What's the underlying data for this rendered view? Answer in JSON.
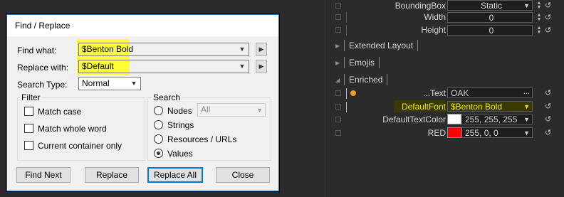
{
  "dialog": {
    "title": "Find / Replace",
    "find_label": "Find what:",
    "find_value": "$Benton Bold",
    "replace_label": "Replace with:",
    "replace_value": "$Default",
    "search_type_label": "Search Type:",
    "search_type_value": "Normal",
    "filter": {
      "title": "Filter",
      "options": [
        "Match case",
        "Match whole word",
        "Current container only"
      ]
    },
    "search": {
      "title": "Search",
      "options": [
        "Nodes",
        "Strings",
        "Resources / URLs",
        "Values"
      ],
      "selected": "Values",
      "nodes_dropdown": "All"
    },
    "buttons": {
      "find_next": "Find Next",
      "replace": "Replace",
      "replace_all": "Replace All",
      "close": "Close"
    }
  },
  "panel": {
    "rows": [
      {
        "label": "BoundingBox",
        "value": "Static"
      },
      {
        "label": "Width",
        "value": "0"
      },
      {
        "label": "Height",
        "value": "0"
      }
    ],
    "sections": {
      "extended_layout": "Extended Layout",
      "emojis": "Emojis",
      "enriched": "Enriched"
    },
    "enriched": {
      "text_label": "...Text",
      "text_value": "OAK",
      "text_button": "...",
      "font_label": "DefaultFont",
      "font_value": "$Benton Bold",
      "color_label": "DefaultTextColor",
      "color_value": "255, 255, 255",
      "red_label": "RED",
      "red_value": "255, 0, 0"
    },
    "colors": {
      "highlight_yellow": "#ffff33",
      "font_field_bg": "#3a3a00",
      "font_text": "#e8e800",
      "swatch_white": "#ffffff",
      "swatch_red": "#ff0000",
      "dot_orange": "#f0a020"
    }
  }
}
